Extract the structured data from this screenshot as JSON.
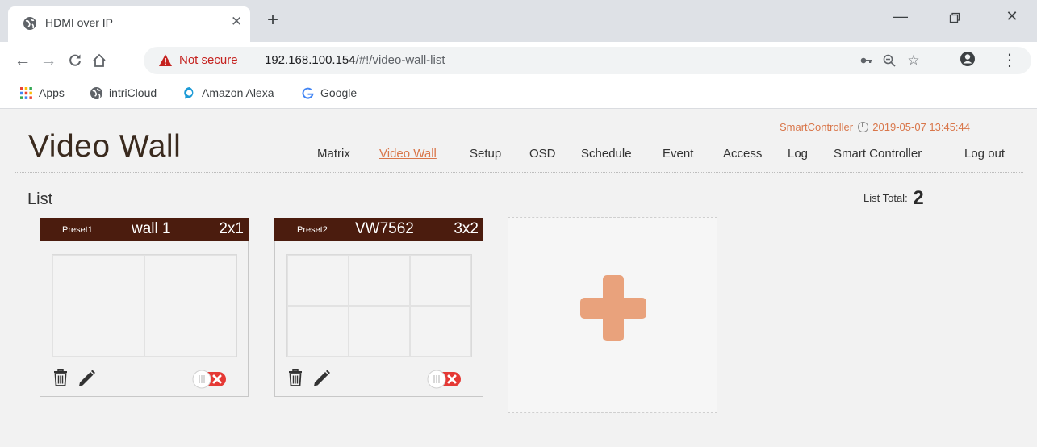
{
  "browser": {
    "tab_title": "HDMI over IP",
    "not_secure": "Not secure",
    "url_host": "192.168.100.154",
    "url_path": "/#!/video-wall-list",
    "bookmarks": [
      "Apps",
      "intriCloud",
      "Amazon Alexa",
      "Google"
    ]
  },
  "header": {
    "title": "Video Wall",
    "controller_name": "SmartController",
    "datetime": "2019-05-07 13:45:44",
    "nav": [
      "Matrix",
      "Video Wall",
      "Setup",
      "OSD",
      "Schedule",
      "Event",
      "Access",
      "Log",
      "Smart Controller",
      "Log out"
    ],
    "active_nav": "Video Wall"
  },
  "list": {
    "title": "List",
    "total_label": "List Total:",
    "total": "2"
  },
  "walls": [
    {
      "preset": "Preset1",
      "name": "wall 1",
      "size": "2x1",
      "cols": 2,
      "rows": 1,
      "enabled": false
    },
    {
      "preset": "Preset2",
      "name": "VW7562",
      "size": "3x2",
      "cols": 3,
      "rows": 2,
      "enabled": false
    }
  ],
  "colors": {
    "accent": "#d9764a",
    "card_header": "#4b1c0e",
    "add_button": "#e9a27c",
    "toggle_off": "#e53935"
  }
}
